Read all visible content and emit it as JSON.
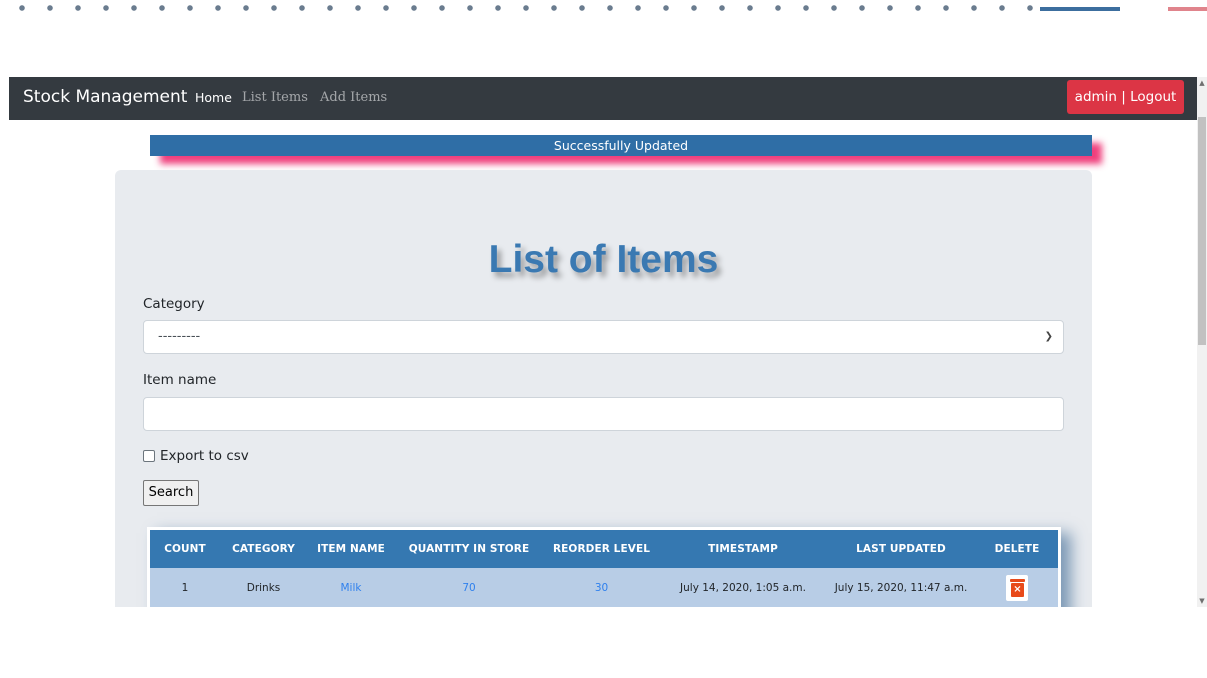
{
  "navbar": {
    "brand": "Stock Management",
    "links": [
      {
        "label": "Home",
        "active": true
      },
      {
        "label": "List Items",
        "active": false
      },
      {
        "label": "Add Items",
        "active": false
      }
    ],
    "logout_label": "admin | Logout"
  },
  "alert": {
    "message": "Successfully Updated"
  },
  "page": {
    "title": "List of Items"
  },
  "form": {
    "category_label": "Category",
    "category_selected": "---------",
    "item_name_label": "Item name",
    "item_name_value": "",
    "export_label": "Export to csv",
    "export_checked": false,
    "search_label": "Search"
  },
  "table": {
    "headers": [
      "COUNT",
      "CATEGORY",
      "ITEM NAME",
      "QUANTITY IN STORE",
      "REORDER LEVEL",
      "TIMESTAMP",
      "LAST UPDATED",
      "DELETE"
    ],
    "rows": [
      {
        "count": "1",
        "category": "Drinks",
        "item_name": "Milk",
        "quantity": "70",
        "reorder_level": "30",
        "timestamp": "July 14, 2020, 1:05 a.m.",
        "last_updated": "July 15, 2020, 11:47 a.m."
      }
    ]
  },
  "colors": {
    "navbar_bg": "#343a40",
    "logout_bg": "#dc3545",
    "alert_bg": "#2f6ea6",
    "panel_bg": "#e8ebef",
    "title_color": "#3a79b2",
    "table_header_bg": "#3578b1",
    "table_row_bg": "#b8cde6",
    "link_color": "#2f80ed",
    "delete_icon": "#e84a1a"
  },
  "icons": {
    "delete": "trash-delete-icon",
    "select": "chevron-down-icon"
  }
}
